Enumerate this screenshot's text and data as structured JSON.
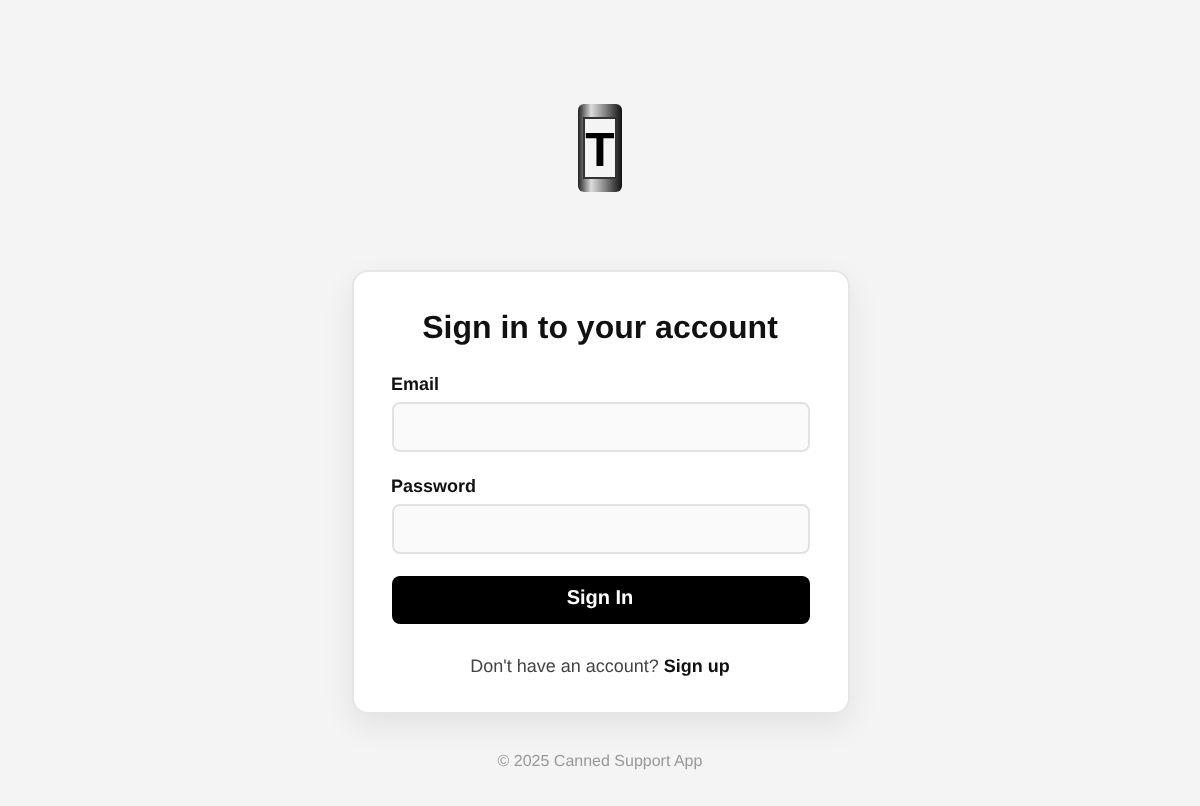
{
  "logo": {
    "letter": "T"
  },
  "card": {
    "title": "Sign in to your account",
    "fields": [
      {
        "label": "Email"
      },
      {
        "label": "Password"
      }
    ],
    "submit": "Sign In",
    "prompt": {
      "text": "Don't have an account?",
      "link": "Sign up"
    }
  },
  "footer": "© 2025 Canned Support App"
}
